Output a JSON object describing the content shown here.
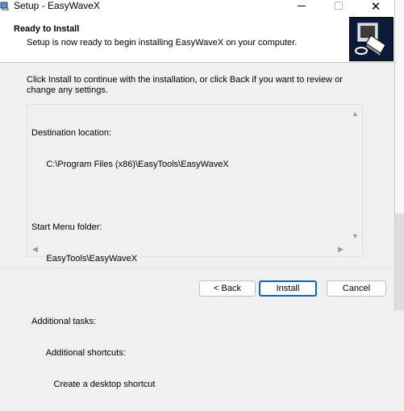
{
  "window": {
    "title": "Setup - EasyWaveX",
    "minimize": "",
    "maximize": "",
    "close": "✕"
  },
  "header": {
    "title": "Ready to Install",
    "subtitle": "Setup is now ready to begin installing EasyWaveX on your computer."
  },
  "instruction": "Click Install to continue with the installation, or click Back if you want to review or change any settings.",
  "memo": {
    "lines": [
      "Destination location:",
      "      C:\\Program Files (x86)\\EasyTools\\EasyWaveX",
      "",
      "Start Menu folder:",
      "      EasyTools\\EasyWaveX",
      "",
      "Additional tasks:",
      "      Additional shortcuts:",
      "         Create a desktop shortcut"
    ]
  },
  "buttons": {
    "back": "< Back",
    "install": "Install",
    "cancel": "Cancel"
  },
  "colors": {
    "accent": "#0067c0",
    "dialog_bg": "#f0f0f0",
    "header_bg": "#ffffff",
    "logo_bg": "#0c1a3a"
  },
  "icons": {
    "app": "installer-icon",
    "logo": "installer-computer-logo"
  }
}
